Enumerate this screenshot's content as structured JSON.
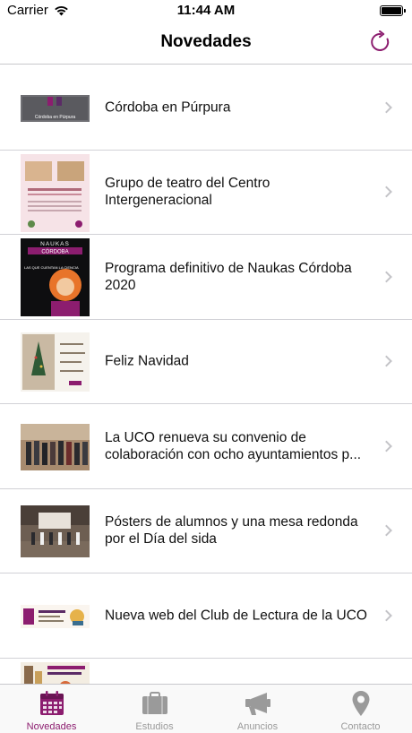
{
  "status": {
    "carrier": "Carrier",
    "time": "11:44 AM"
  },
  "nav": {
    "title": "Novedades",
    "refresh_icon": "refresh-icon"
  },
  "items": [
    {
      "title": "Córdoba en Púrpura",
      "thumb_kind": "banner",
      "thumb_caption": "Córdoba en Púrpura"
    },
    {
      "title": "Grupo de teatro del Centro Intergeneracional",
      "thumb_kind": "poster-pink"
    },
    {
      "title": "Programa definitivo de Naukas Córdoba 2020",
      "thumb_kind": "naukas",
      "thumb_heading": "NAUKAS",
      "thumb_subheading": "CÓRDOBA",
      "thumb_text": "LAS QUE CUENTAN LA CIENCIA"
    },
    {
      "title": "Feliz Navidad",
      "thumb_kind": "navidad"
    },
    {
      "title": "La UCO renueva su convenio de colaboración con ocho ayuntamientos p...",
      "thumb_kind": "photo-group"
    },
    {
      "title": "Pósters de alumnos y una mesa redonda por el Día del sida",
      "thumb_kind": "photo-room"
    },
    {
      "title": "Nueva web del Club de Lectura de la UCO",
      "thumb_kind": "banner-club"
    },
    {
      "title": "",
      "thumb_kind": "poster-partial"
    }
  ],
  "tabs": [
    {
      "label": "Novedades",
      "icon": "calendar-icon",
      "active": true
    },
    {
      "label": "Estudios",
      "icon": "briefcase-icon",
      "active": false
    },
    {
      "label": "Anuncios",
      "icon": "megaphone-icon",
      "active": false
    },
    {
      "label": "Contacto",
      "icon": "location-pin-icon",
      "active": false
    }
  ],
  "colors": {
    "accent": "#8c1d6f",
    "inactive": "#9a9a9a",
    "separator": "#d1d1d6"
  }
}
